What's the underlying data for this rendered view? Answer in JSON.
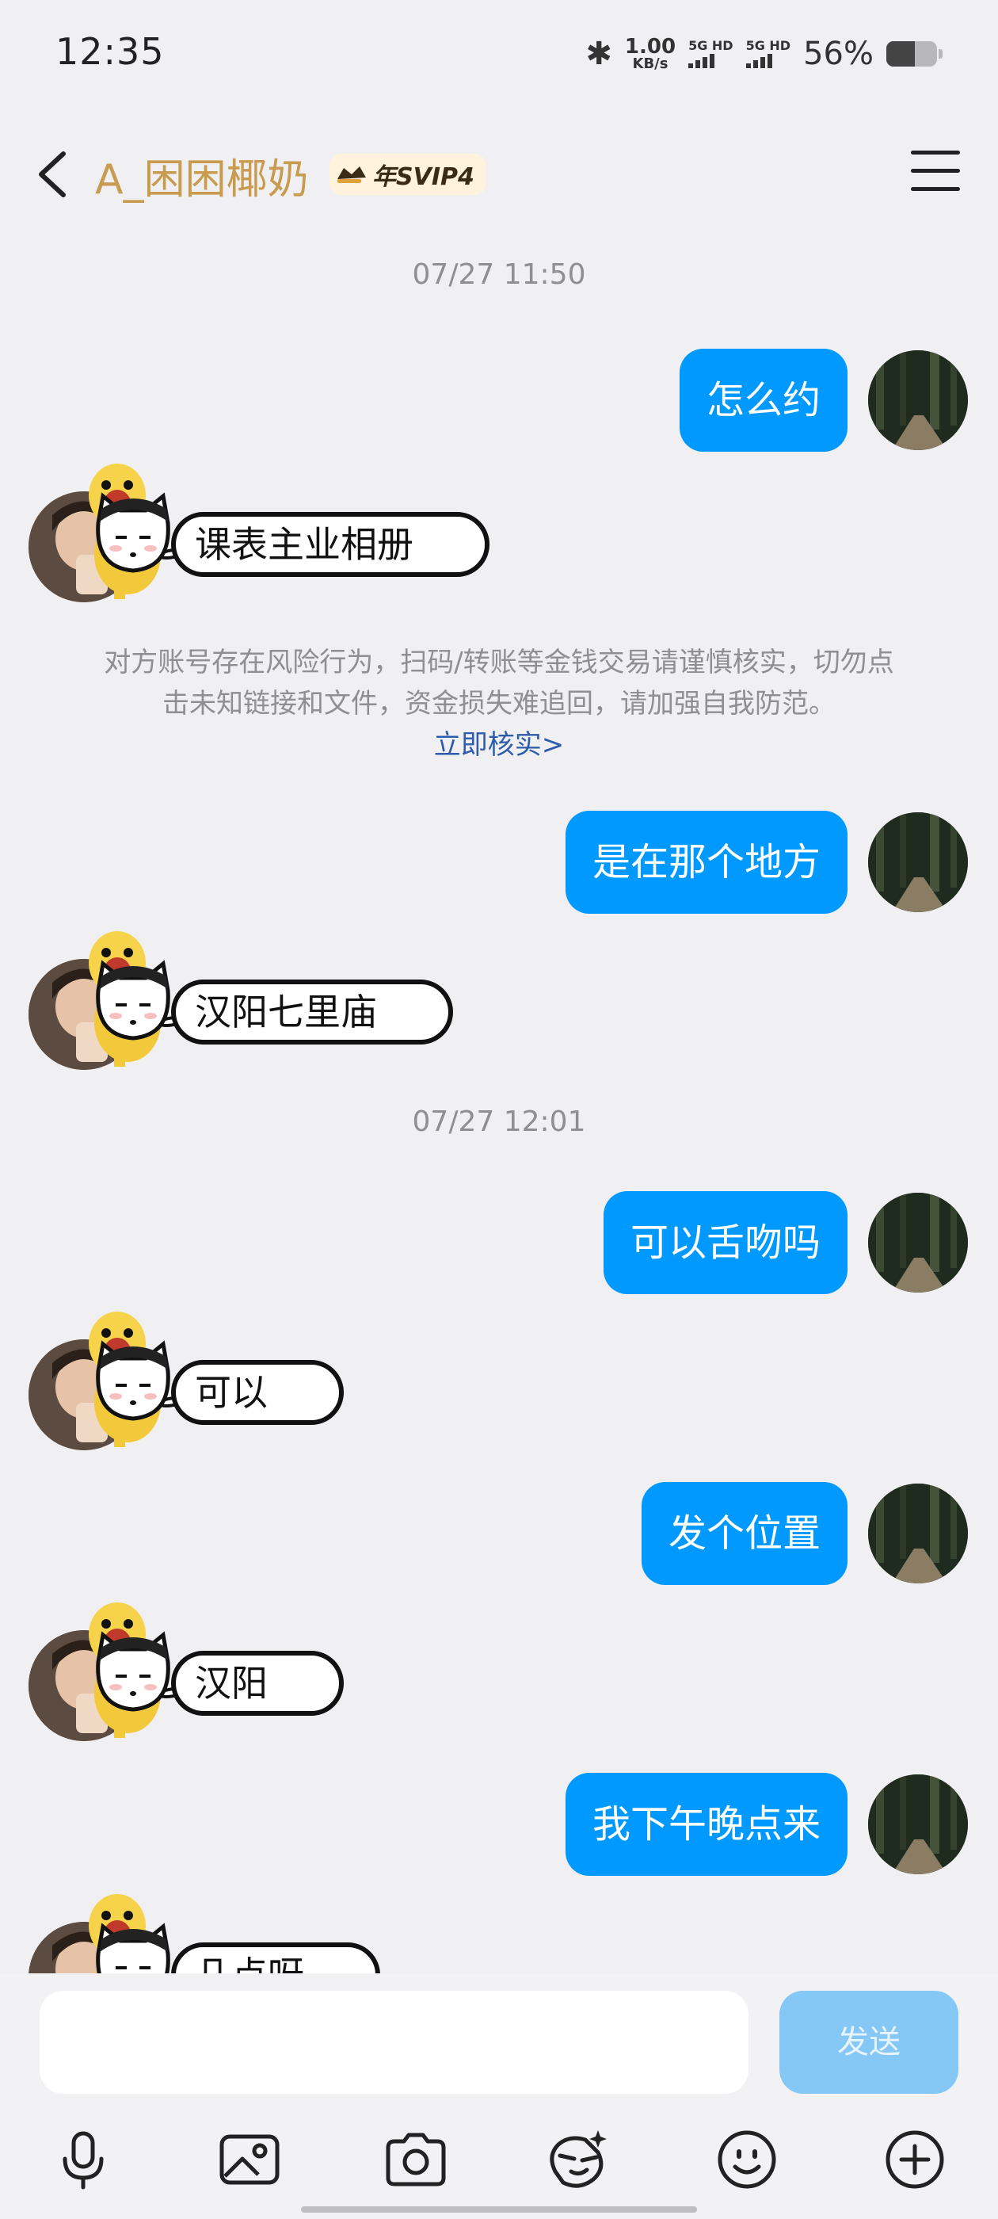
{
  "status_bar": {
    "time": "12:35",
    "net_speed_value": "1.00",
    "net_speed_unit": "KB/s",
    "sim1_label": "5G HD",
    "sim2_label": "5G HD",
    "battery_percent": "56%",
    "battery_level": 0.56
  },
  "header": {
    "contact_name": "A_困困椰奶",
    "vip_badge": "年SVIP4",
    "name_color": "#c89b4f"
  },
  "messages": [
    {
      "type": "timestamp",
      "text": "07/27 11:50"
    },
    {
      "type": "outgoing",
      "text": "怎么约"
    },
    {
      "type": "incoming_sticker",
      "text": "课表主业相册"
    },
    {
      "type": "warning",
      "text_line1": "对方账号存在风险行为，扫码/转账等金钱交易请谨慎核实，切勿点",
      "text_line2": "击未知链接和文件，资金损失难追回，请加强自我防范。",
      "link": "立即核实>"
    },
    {
      "type": "outgoing",
      "text": "是在那个地方"
    },
    {
      "type": "incoming_sticker",
      "text": "汉阳七里庙"
    },
    {
      "type": "timestamp",
      "text": "07/27 12:01"
    },
    {
      "type": "outgoing",
      "text": "可以舌吻吗"
    },
    {
      "type": "incoming_sticker",
      "text": "可以"
    },
    {
      "type": "outgoing",
      "text": "发个位置"
    },
    {
      "type": "incoming_sticker",
      "text": "汉阳"
    },
    {
      "type": "outgoing",
      "text": "我下午晚点来"
    },
    {
      "type": "incoming_sticker",
      "text": "几点呀"
    }
  ],
  "composer": {
    "input_value": "",
    "send_label": "发送"
  },
  "toolbar": [
    "microphone-icon",
    "image-icon",
    "camera-icon",
    "sticker-icon",
    "emoji-icon",
    "plus-icon"
  ],
  "colors": {
    "outgoing_bubble": "#0099ff",
    "background": "#f0f0f3",
    "link": "#2e5bab"
  }
}
